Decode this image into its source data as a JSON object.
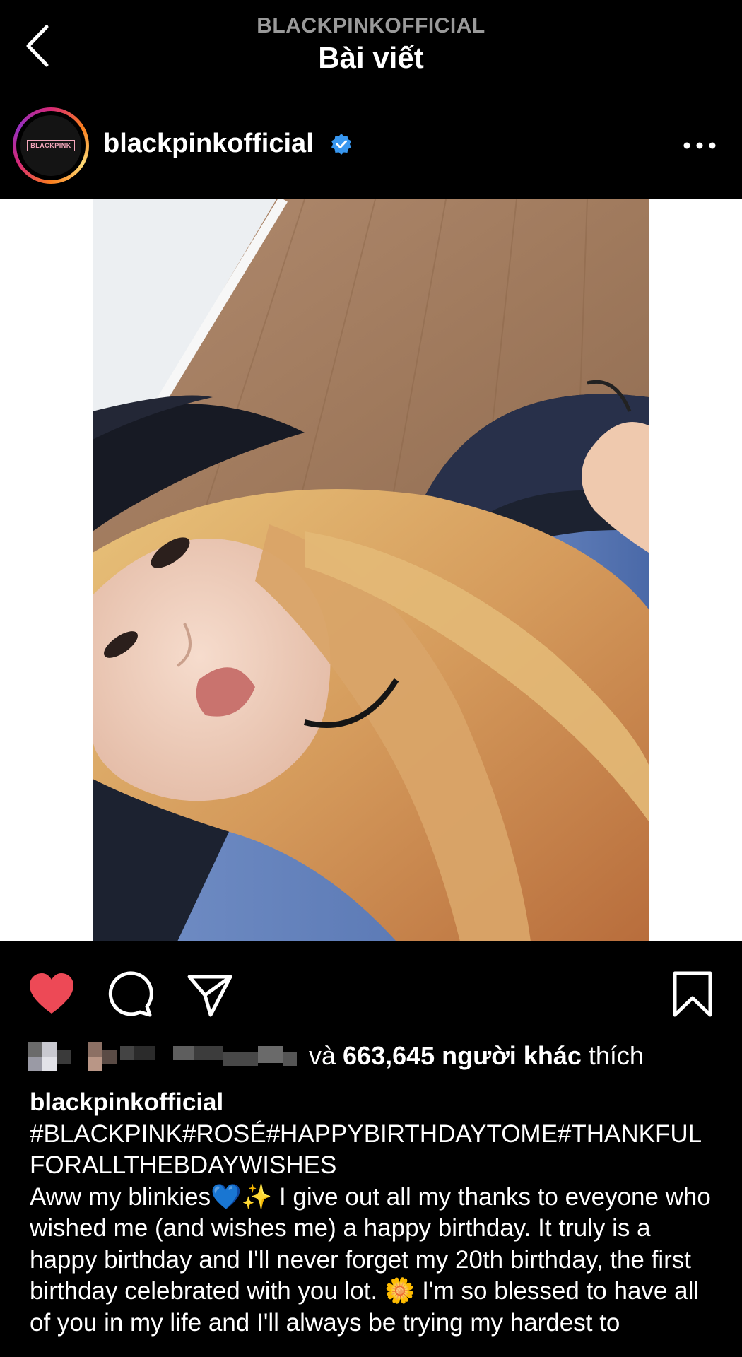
{
  "header": {
    "account": "BLACKPINKOFFICIAL",
    "title": "Bài viết"
  },
  "post": {
    "username": "blackpinkofficial",
    "avatar_logo": "BLACKPINK",
    "likes_prefix": "và ",
    "likes_count": "663,645 người khác",
    "likes_suffix": " thích",
    "caption_user": "blackpinkofficial",
    "caption_tags": "#BLACKPINK#ROSÉ#HAPPYBIRTHDAYTOME#THANKFULFORALLTHEBDAYWISHES",
    "caption_body": "Aww my blinkies💙✨ I give out all my thanks to eveyone who wished me (and wishes me) a happy birthday. It truly is a happy birthday and I'll never forget my 20th birthday, the first birthday celebrated with you lot. 🌼 I'm so blessed to have all of you in my life and I'll always be trying my hardest to"
  },
  "colors": {
    "heart": "#ed4956",
    "verified": "#3897f0",
    "background": "#000000"
  },
  "icons": {
    "back": "chevron-left-icon",
    "verified": "verified-badge-icon",
    "more": "more-horizontal-icon",
    "like": "heart-filled-icon",
    "comment": "comment-icon",
    "share": "paper-plane-icon",
    "save": "bookmark-icon"
  }
}
